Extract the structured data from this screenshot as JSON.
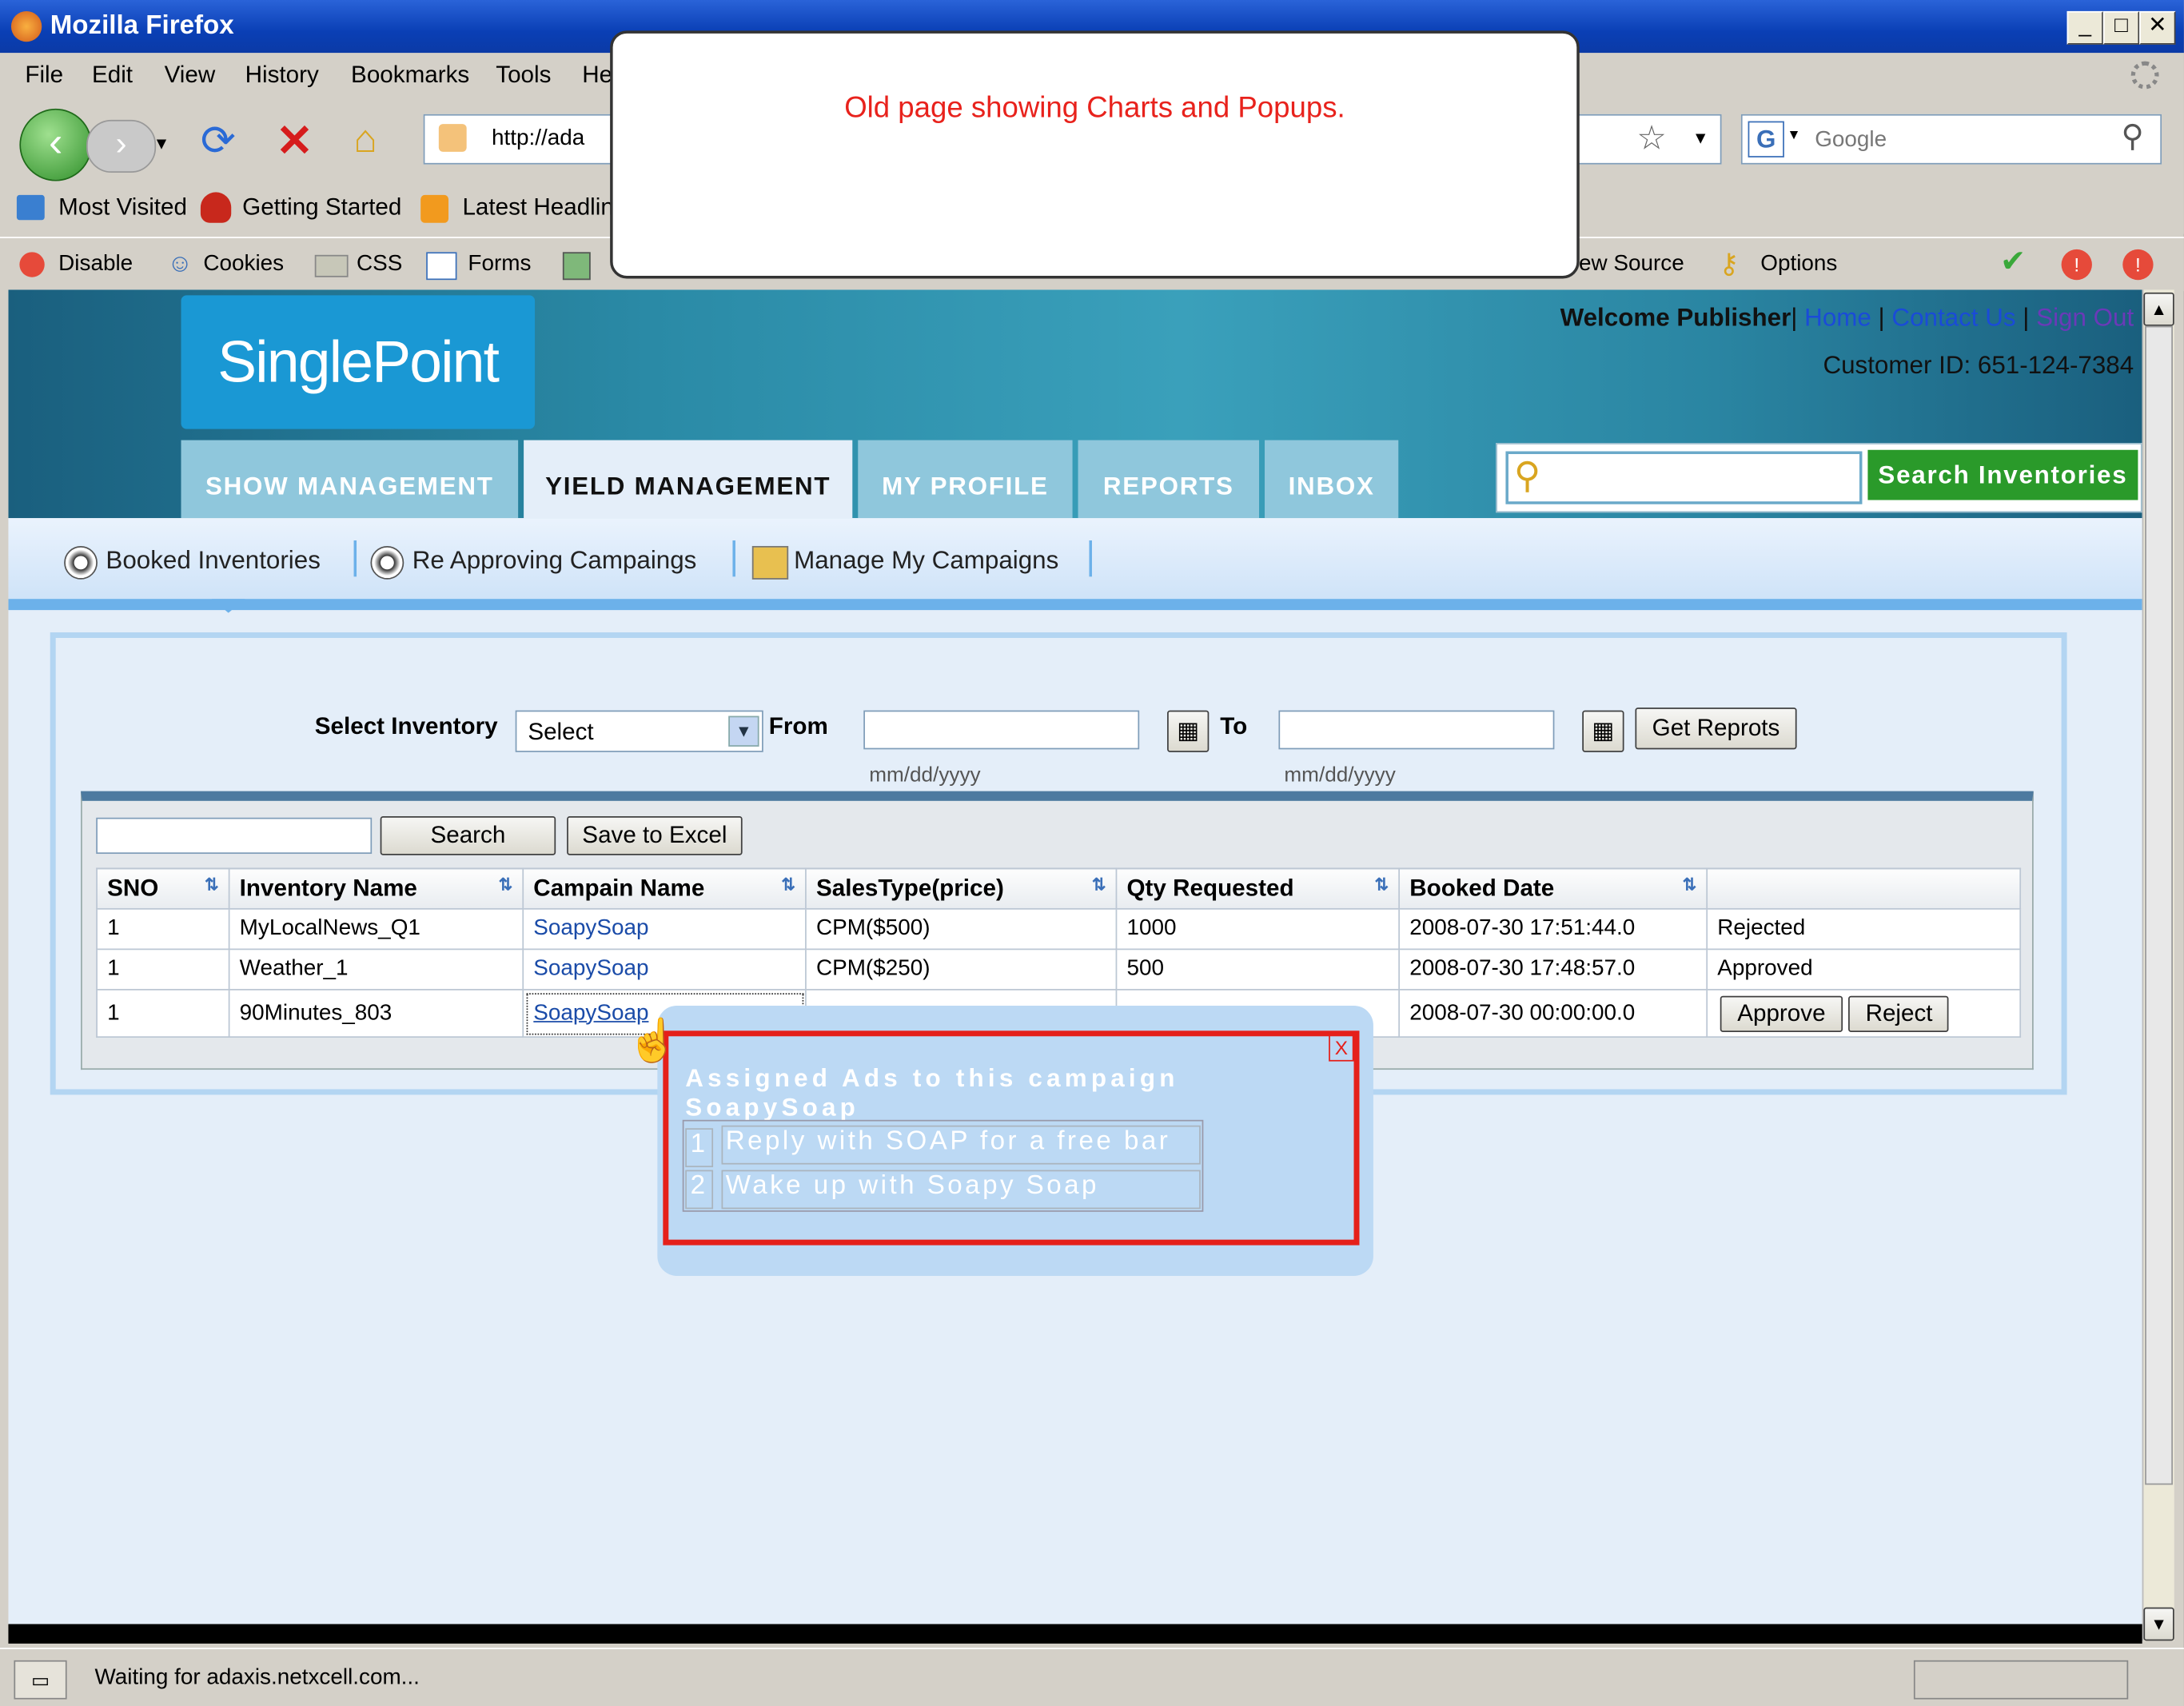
{
  "window": {
    "title": "Mozilla Firefox",
    "min": "_",
    "max": "□",
    "close": "✕"
  },
  "menu": [
    "File",
    "Edit",
    "View",
    "History",
    "Bookmarks",
    "Tools",
    "He"
  ],
  "nav": {
    "url": "http://ada",
    "search_placeholder": "Google"
  },
  "bookmarks": [
    "Most Visited",
    "Getting Started",
    "Latest Headlin"
  ],
  "devtools": {
    "disable": "Disable",
    "cookies": "Cookies",
    "css": "CSS",
    "forms": "Forms",
    "view_source": "iew Source",
    "options": "Options"
  },
  "site": {
    "logo": "SinglePoint",
    "welcome": "Welcome Publisher",
    "links": [
      "Home",
      "Contact Us",
      "Sign Out"
    ],
    "customer": "Customer ID: 651-124-7384",
    "search_button": "Search Inventories",
    "tabs": [
      "SHOW MANAGEMENT",
      "YIELD MANAGEMENT",
      "MY PROFILE",
      "REPORTS",
      "INBOX"
    ],
    "subnav": [
      "Booked Inventories",
      "Re Approving Campaings",
      "Manage My Campaigns"
    ]
  },
  "filters": {
    "select_label": "Select Inventory",
    "select_value": "Select",
    "from_label": "From",
    "to_label": "To",
    "date_hint": "mm/dd/yyyy",
    "get_button": "Get Reprots"
  },
  "grid": {
    "search_button": "Search",
    "excel_button": "Save to Excel",
    "columns": [
      "SNO",
      "Inventory Name",
      "Campain Name",
      "SalesType(price)",
      "Qty Requested",
      "Booked Date",
      ""
    ],
    "rows": [
      [
        "1",
        "MyLocalNews_Q1",
        "SoapySoap",
        "CPM($500)",
        "1000",
        "2008-07-30 17:51:44.0",
        "Rejected"
      ],
      [
        "1",
        "Weather_1",
        "SoapySoap",
        "CPM($250)",
        "500",
        "2008-07-30 17:48:57.0",
        "Approved"
      ],
      [
        "1",
        "90Minutes_803",
        "SoapySoap",
        "",
        "",
        "2008-07-30 00:00:00.0",
        ""
      ]
    ],
    "approve": "Approve",
    "reject": "Reject"
  },
  "note": "Old page showing Charts and Popups.",
  "ads_popup": {
    "title": "Assigned Ads to this campaign SoapySoap",
    "close": "X",
    "items": [
      {
        "n": "1",
        "text": "Reply with SOAP for a free bar"
      },
      {
        "n": "2",
        "text": "Wake up with Soapy Soap"
      }
    ]
  },
  "status": "Waiting for adaxis.netxcell.com..."
}
